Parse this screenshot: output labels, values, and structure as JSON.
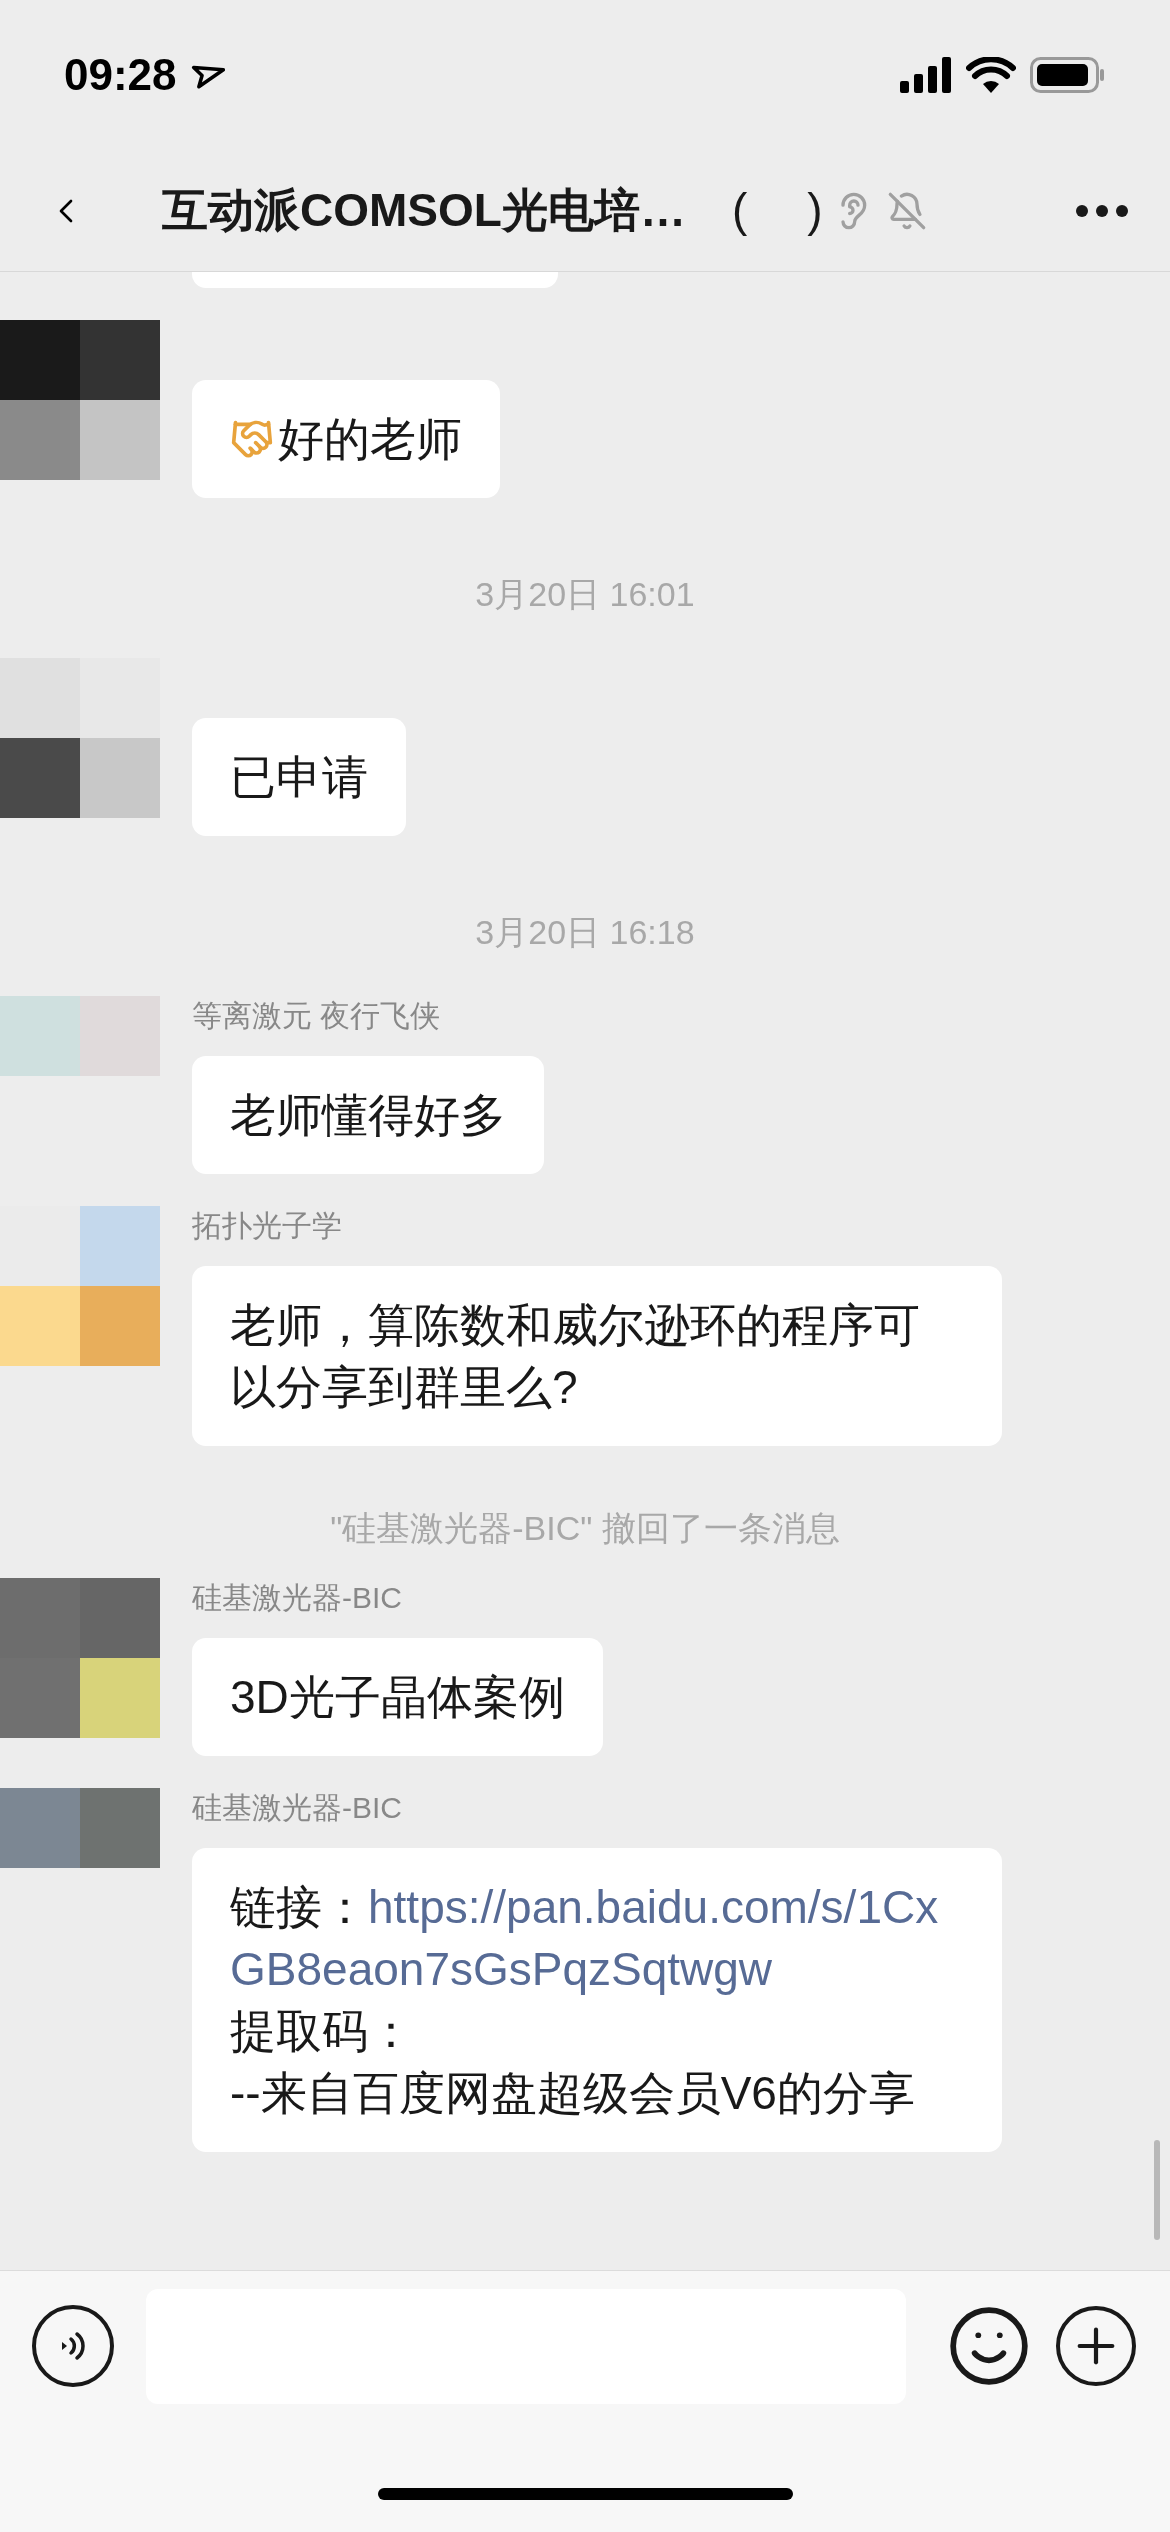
{
  "status_bar": {
    "time": "09:28"
  },
  "header": {
    "title": "互动派COMSOL光电培…",
    "paren_open": "(",
    "paren_close": ")",
    "earpiece": true,
    "muted": true
  },
  "messages": [
    {
      "kind": "partial"
    },
    {
      "kind": "message",
      "text": "好的老师",
      "emoji": true
    },
    {
      "kind": "time",
      "text": "3月20日 16:01"
    },
    {
      "kind": "message",
      "text": "已申请"
    },
    {
      "kind": "time",
      "text": "3月20日 16:18"
    },
    {
      "kind": "message",
      "name": "等离激元 夜行飞侠",
      "text": "老师懂得好多"
    },
    {
      "kind": "message",
      "name": "拓扑光子学",
      "text": "老师，算陈数和威尔逊环的程序可以分享到群里么?"
    },
    {
      "kind": "notice",
      "text": "\"硅基激光器-BIC\" 撤回了一条消息"
    },
    {
      "kind": "message",
      "name": "硅基激光器-BIC",
      "text": "3D光子晶体案例"
    },
    {
      "kind": "share",
      "name": "硅基激光器-BIC",
      "link_label": "链接：",
      "link": "https://pan.baidu.com/s/1CxGB8eaon7sGsPqzSqtwgw",
      "code_label": "提取码：",
      "footer": "--来自百度网盘超级会员V6的分享"
    }
  ]
}
